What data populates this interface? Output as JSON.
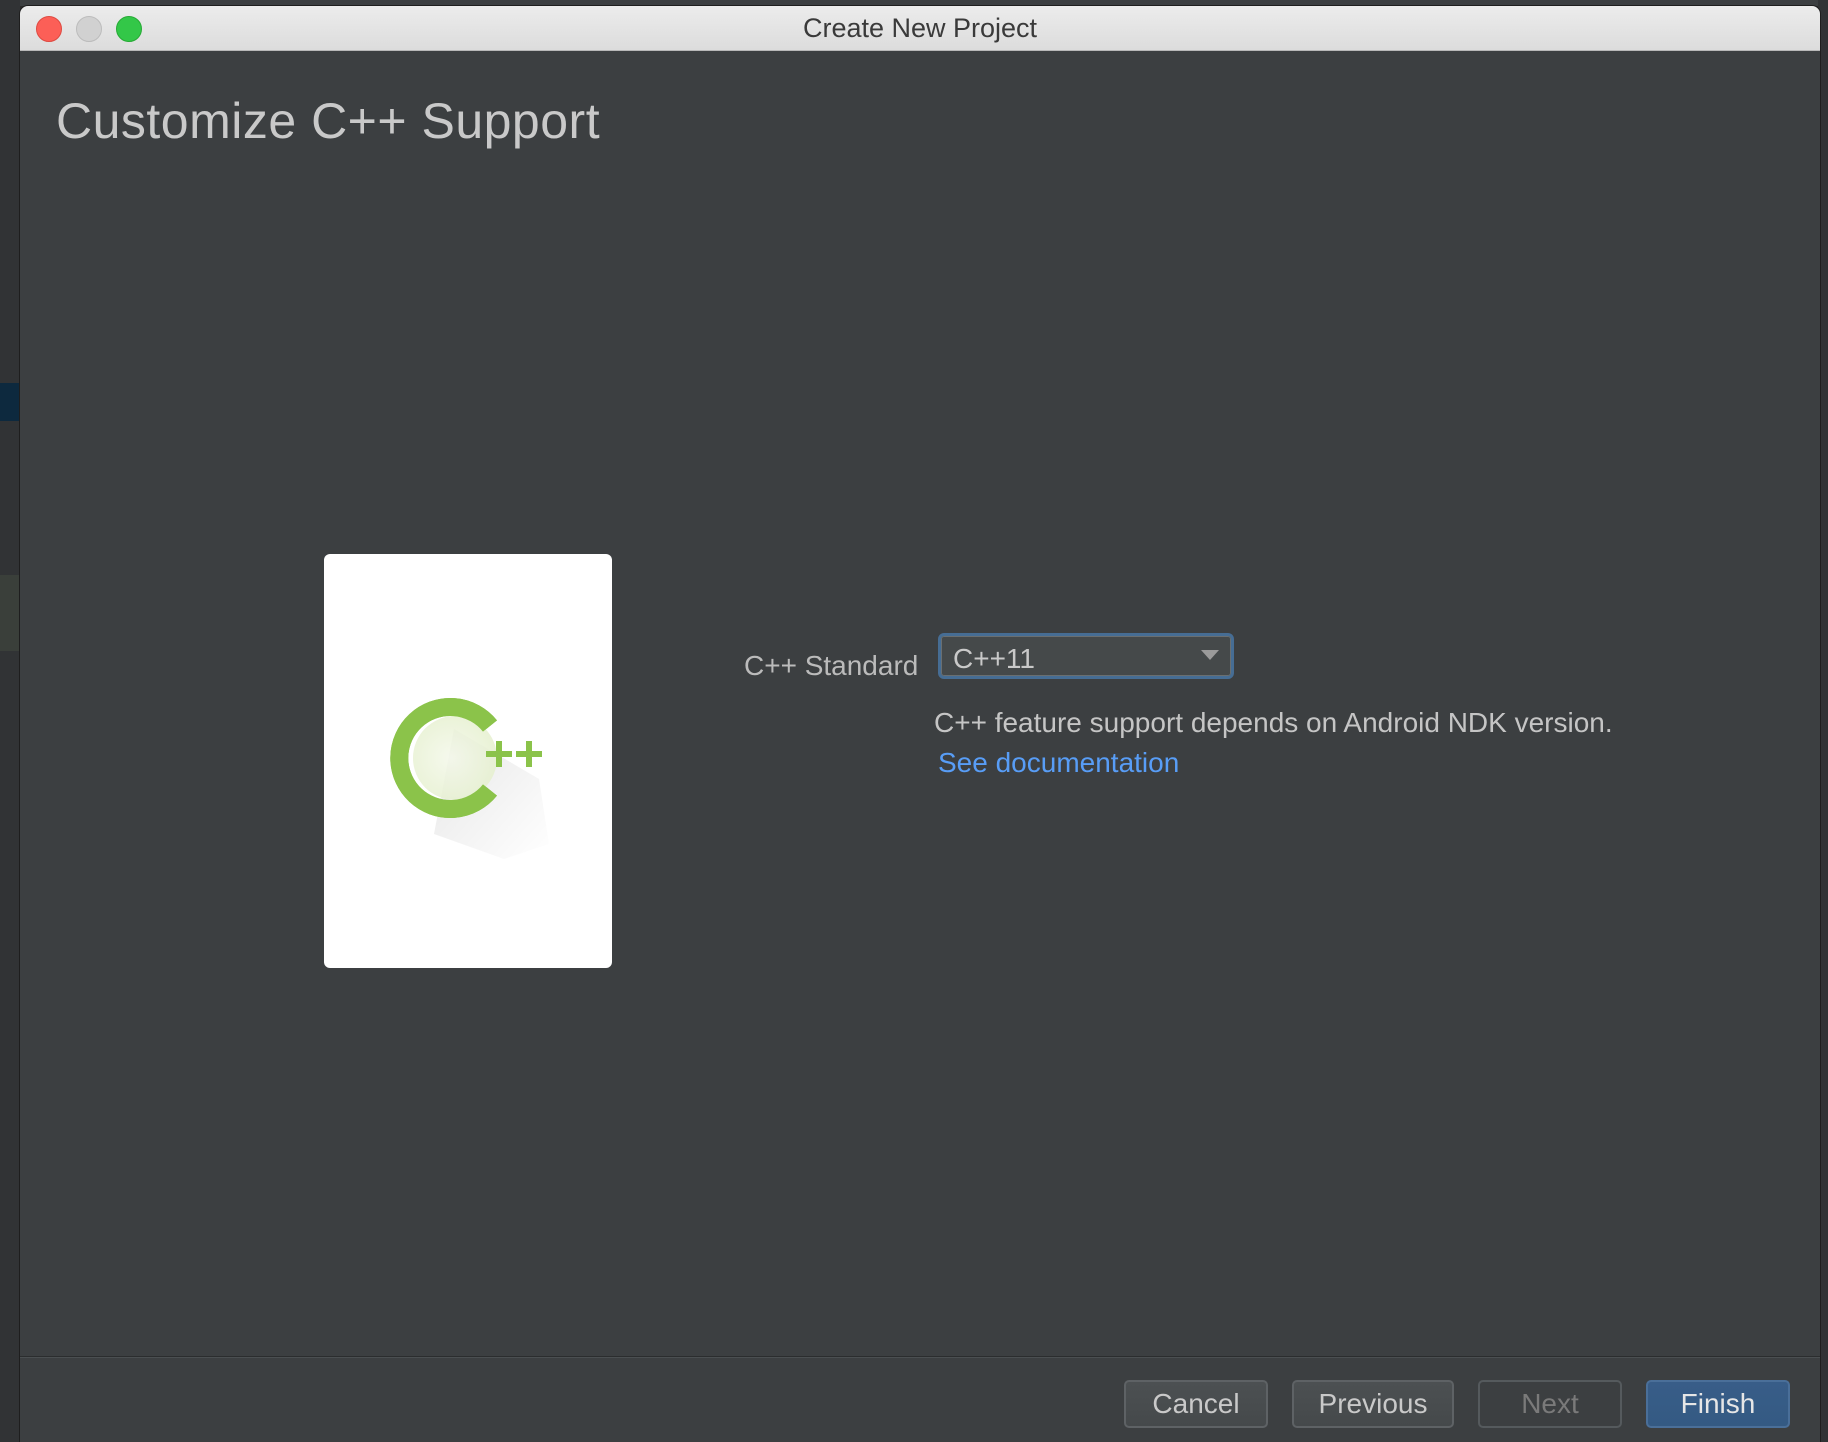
{
  "window": {
    "title": "Create New Project"
  },
  "page": {
    "heading": "Customize C++ Support"
  },
  "illustration": {
    "icon": "cpp-logo-icon",
    "brand_color": "#8bc34a"
  },
  "form": {
    "cpp_standard": {
      "label": "C++ Standard",
      "selected": "C++11"
    },
    "hint": "C++ feature support depends on Android NDK version.",
    "link_label": "See documentation"
  },
  "footer": {
    "buttons": {
      "cancel": "Cancel",
      "previous": "Previous",
      "next": "Next",
      "finish": "Finish"
    }
  },
  "colors": {
    "dialog_bg": "#3c3f41",
    "link": "#589df6",
    "primary_button": "#365880",
    "focus_border": "#466d94"
  }
}
